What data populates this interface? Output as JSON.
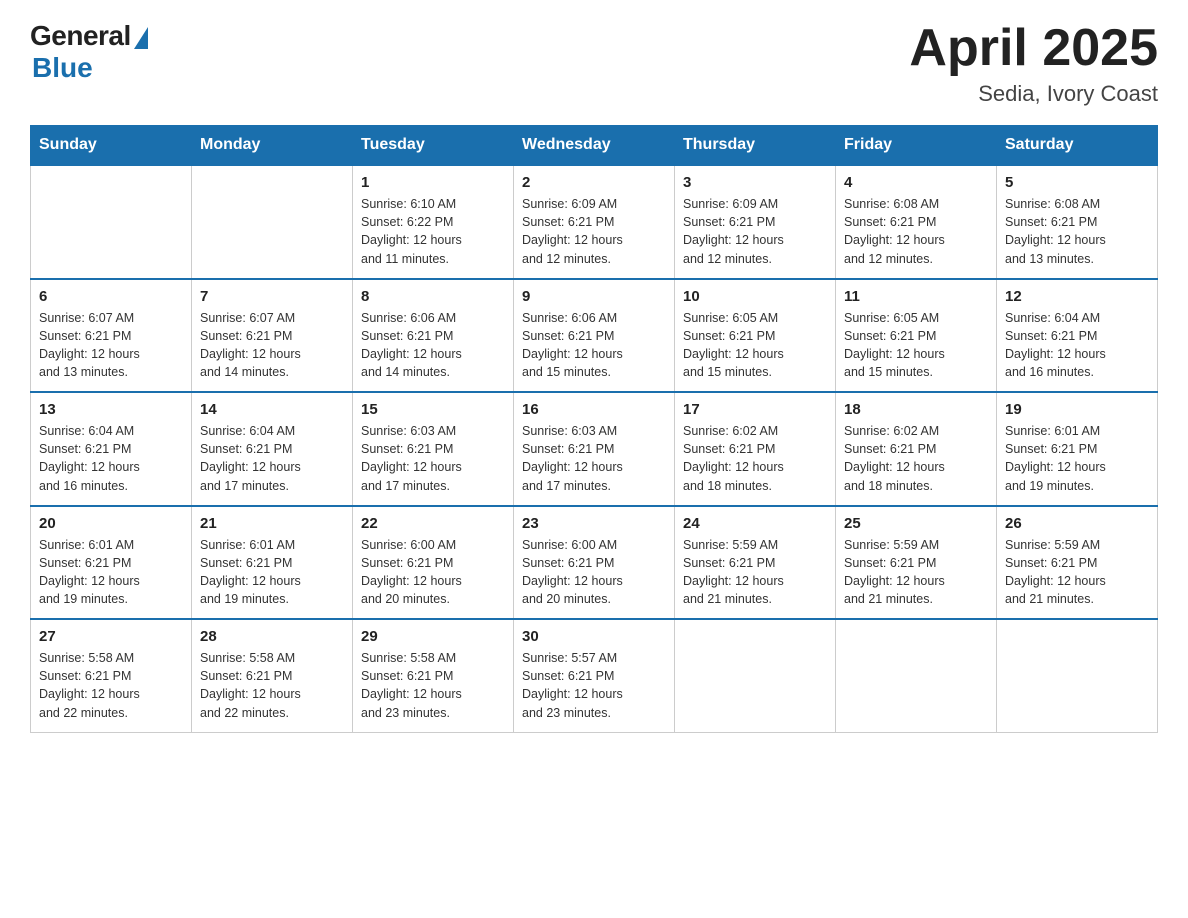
{
  "header": {
    "logo": {
      "general": "General",
      "blue": "Blue"
    },
    "title": "April 2025",
    "location": "Sedia, Ivory Coast"
  },
  "days_of_week": [
    "Sunday",
    "Monday",
    "Tuesday",
    "Wednesday",
    "Thursday",
    "Friday",
    "Saturday"
  ],
  "weeks": [
    [
      {
        "day": "",
        "info": ""
      },
      {
        "day": "",
        "info": ""
      },
      {
        "day": "1",
        "info": "Sunrise: 6:10 AM\nSunset: 6:22 PM\nDaylight: 12 hours\nand 11 minutes."
      },
      {
        "day": "2",
        "info": "Sunrise: 6:09 AM\nSunset: 6:21 PM\nDaylight: 12 hours\nand 12 minutes."
      },
      {
        "day": "3",
        "info": "Sunrise: 6:09 AM\nSunset: 6:21 PM\nDaylight: 12 hours\nand 12 minutes."
      },
      {
        "day": "4",
        "info": "Sunrise: 6:08 AM\nSunset: 6:21 PM\nDaylight: 12 hours\nand 12 minutes."
      },
      {
        "day": "5",
        "info": "Sunrise: 6:08 AM\nSunset: 6:21 PM\nDaylight: 12 hours\nand 13 minutes."
      }
    ],
    [
      {
        "day": "6",
        "info": "Sunrise: 6:07 AM\nSunset: 6:21 PM\nDaylight: 12 hours\nand 13 minutes."
      },
      {
        "day": "7",
        "info": "Sunrise: 6:07 AM\nSunset: 6:21 PM\nDaylight: 12 hours\nand 14 minutes."
      },
      {
        "day": "8",
        "info": "Sunrise: 6:06 AM\nSunset: 6:21 PM\nDaylight: 12 hours\nand 14 minutes."
      },
      {
        "day": "9",
        "info": "Sunrise: 6:06 AM\nSunset: 6:21 PM\nDaylight: 12 hours\nand 15 minutes."
      },
      {
        "day": "10",
        "info": "Sunrise: 6:05 AM\nSunset: 6:21 PM\nDaylight: 12 hours\nand 15 minutes."
      },
      {
        "day": "11",
        "info": "Sunrise: 6:05 AM\nSunset: 6:21 PM\nDaylight: 12 hours\nand 15 minutes."
      },
      {
        "day": "12",
        "info": "Sunrise: 6:04 AM\nSunset: 6:21 PM\nDaylight: 12 hours\nand 16 minutes."
      }
    ],
    [
      {
        "day": "13",
        "info": "Sunrise: 6:04 AM\nSunset: 6:21 PM\nDaylight: 12 hours\nand 16 minutes."
      },
      {
        "day": "14",
        "info": "Sunrise: 6:04 AM\nSunset: 6:21 PM\nDaylight: 12 hours\nand 17 minutes."
      },
      {
        "day": "15",
        "info": "Sunrise: 6:03 AM\nSunset: 6:21 PM\nDaylight: 12 hours\nand 17 minutes."
      },
      {
        "day": "16",
        "info": "Sunrise: 6:03 AM\nSunset: 6:21 PM\nDaylight: 12 hours\nand 17 minutes."
      },
      {
        "day": "17",
        "info": "Sunrise: 6:02 AM\nSunset: 6:21 PM\nDaylight: 12 hours\nand 18 minutes."
      },
      {
        "day": "18",
        "info": "Sunrise: 6:02 AM\nSunset: 6:21 PM\nDaylight: 12 hours\nand 18 minutes."
      },
      {
        "day": "19",
        "info": "Sunrise: 6:01 AM\nSunset: 6:21 PM\nDaylight: 12 hours\nand 19 minutes."
      }
    ],
    [
      {
        "day": "20",
        "info": "Sunrise: 6:01 AM\nSunset: 6:21 PM\nDaylight: 12 hours\nand 19 minutes."
      },
      {
        "day": "21",
        "info": "Sunrise: 6:01 AM\nSunset: 6:21 PM\nDaylight: 12 hours\nand 19 minutes."
      },
      {
        "day": "22",
        "info": "Sunrise: 6:00 AM\nSunset: 6:21 PM\nDaylight: 12 hours\nand 20 minutes."
      },
      {
        "day": "23",
        "info": "Sunrise: 6:00 AM\nSunset: 6:21 PM\nDaylight: 12 hours\nand 20 minutes."
      },
      {
        "day": "24",
        "info": "Sunrise: 5:59 AM\nSunset: 6:21 PM\nDaylight: 12 hours\nand 21 minutes."
      },
      {
        "day": "25",
        "info": "Sunrise: 5:59 AM\nSunset: 6:21 PM\nDaylight: 12 hours\nand 21 minutes."
      },
      {
        "day": "26",
        "info": "Sunrise: 5:59 AM\nSunset: 6:21 PM\nDaylight: 12 hours\nand 21 minutes."
      }
    ],
    [
      {
        "day": "27",
        "info": "Sunrise: 5:58 AM\nSunset: 6:21 PM\nDaylight: 12 hours\nand 22 minutes."
      },
      {
        "day": "28",
        "info": "Sunrise: 5:58 AM\nSunset: 6:21 PM\nDaylight: 12 hours\nand 22 minutes."
      },
      {
        "day": "29",
        "info": "Sunrise: 5:58 AM\nSunset: 6:21 PM\nDaylight: 12 hours\nand 23 minutes."
      },
      {
        "day": "30",
        "info": "Sunrise: 5:57 AM\nSunset: 6:21 PM\nDaylight: 12 hours\nand 23 minutes."
      },
      {
        "day": "",
        "info": ""
      },
      {
        "day": "",
        "info": ""
      },
      {
        "day": "",
        "info": ""
      }
    ]
  ]
}
